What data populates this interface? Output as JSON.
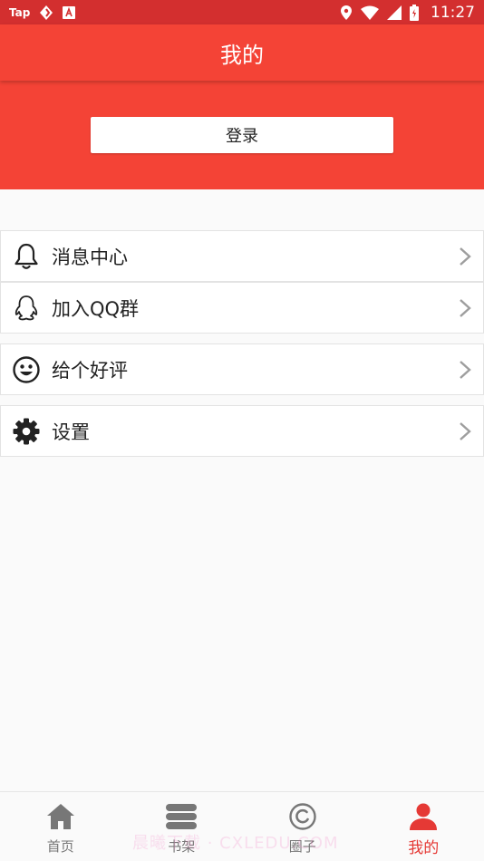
{
  "status_bar": {
    "left_text": "Tap",
    "time": "11:27",
    "icons": [
      "tap-app-icon",
      "sync-icon",
      "font-icon",
      "location-icon",
      "wifi-icon",
      "signal-icon",
      "battery-icon"
    ]
  },
  "app_bar": {
    "title": "我的"
  },
  "header": {
    "login_label": "登录"
  },
  "menu": {
    "items": [
      {
        "label": "消息中心",
        "icon": "bell-icon"
      },
      {
        "label": "加入QQ群",
        "icon": "qq-icon"
      },
      {
        "label": "给个好评",
        "icon": "smiley-icon"
      },
      {
        "label": "设置",
        "icon": "gear-icon"
      }
    ]
  },
  "bottom_nav": {
    "items": [
      {
        "label": "首页",
        "icon": "home-icon",
        "active": false
      },
      {
        "label": "书架",
        "icon": "bookshelf-icon",
        "active": false
      },
      {
        "label": "圈子",
        "icon": "circle-icon",
        "active": false
      },
      {
        "label": "我的",
        "icon": "person-icon",
        "active": true
      }
    ]
  },
  "watermark": "晨曦下载 · CXLEDU.COM",
  "colors": {
    "primary": "#f44336",
    "status_bar": "#d32f2f",
    "active_nav": "#e53935",
    "inactive_nav": "#777777"
  }
}
